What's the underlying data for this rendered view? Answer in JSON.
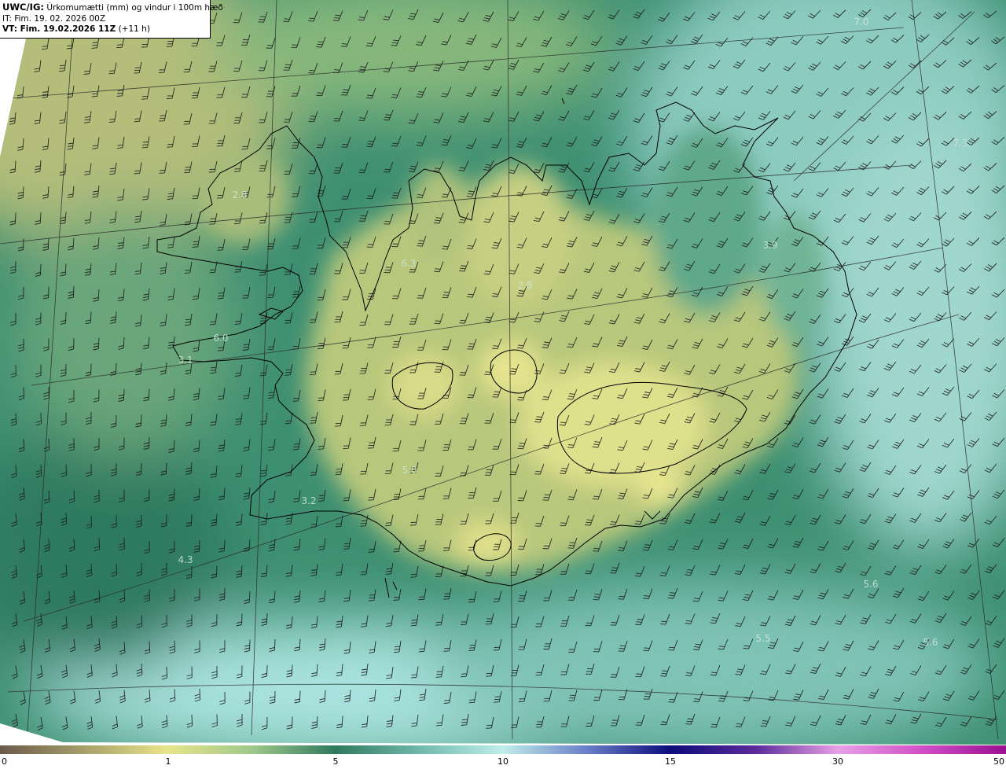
{
  "header": {
    "line1_bold": "UWC/IG:",
    "line1_rest": " Úrkomumætti (mm) og vindur i 100m hæð",
    "line2": "IT: Fim. 19. 02. 2026 00Z",
    "line3_bold": "VT: Fim. 19.02.2026 11Z",
    "line3_rest": " (+11 h)"
  },
  "colors": {
    "coast": "#000000",
    "grid": "#2a2a2a",
    "barb": "#1a1a1a",
    "value_text": "#cfe8dc"
  },
  "colorbar": {
    "ticks": [
      "0",
      "1",
      "5",
      "10",
      "15",
      "30",
      "50"
    ],
    "stops": [
      {
        "t": 0.0,
        "c": "#6b5a4a"
      },
      {
        "t": 0.083,
        "c": "#a69f6a"
      },
      {
        "t": 0.166,
        "c": "#e8e48a"
      },
      {
        "t": 0.25,
        "c": "#9fc98a"
      },
      {
        "t": 0.333,
        "c": "#2f7a5e"
      },
      {
        "t": 0.416,
        "c": "#6fb8aa"
      },
      {
        "t": 0.5,
        "c": "#bfeeea"
      },
      {
        "t": 0.583,
        "c": "#6a7fc9"
      },
      {
        "t": 0.666,
        "c": "#0c0c7a"
      },
      {
        "t": 0.75,
        "c": "#5a2a9a"
      },
      {
        "t": 0.833,
        "c": "#e8a0e6"
      },
      {
        "t": 0.916,
        "c": "#d050c8"
      },
      {
        "t": 1.0,
        "c": "#9a1090"
      }
    ]
  },
  "map_values": [
    {
      "label": "7.0"
    },
    {
      "label": "2.8"
    },
    {
      "label": "7.3"
    },
    {
      "label": "6.3"
    },
    {
      "label": "3.9"
    },
    {
      "label": "2.8"
    },
    {
      "label": "6.0"
    },
    {
      "label": "3.1"
    },
    {
      "label": "5.0"
    },
    {
      "label": "3.2"
    },
    {
      "label": "4.3"
    },
    {
      "label": "5.6"
    },
    {
      "label": "5.5"
    },
    {
      "label": "5.6"
    }
  ],
  "wind_barbs": {
    "direction_deg": 200,
    "note_visible": false
  }
}
